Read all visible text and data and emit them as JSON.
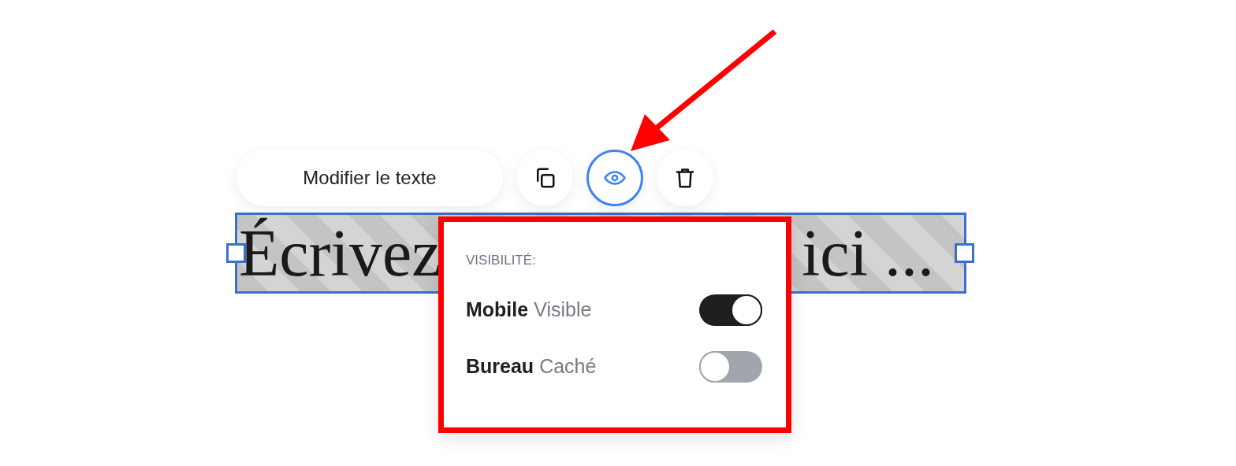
{
  "toolbar": {
    "edit_button": "Modifier le texte",
    "actions": [
      {
        "kind": "duplicate",
        "selected": false
      },
      {
        "kind": "visibility",
        "selected": true
      },
      {
        "kind": "delete",
        "selected": false
      }
    ]
  },
  "text_block": {
    "fragments": [
      "Écrivez",
      "ici ..."
    ]
  },
  "visibility_popup": {
    "title": "VISIBILITÉ:",
    "rows": [
      {
        "device": "Mobile",
        "status": "Visible",
        "on": true
      },
      {
        "device": "Bureau",
        "status": "Caché",
        "on": false
      }
    ]
  }
}
